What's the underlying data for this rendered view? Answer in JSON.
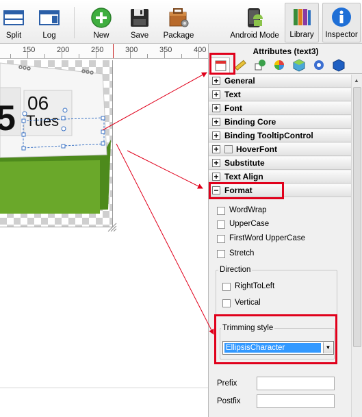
{
  "toolbar": {
    "split": "Split",
    "log": "Log",
    "new": "New",
    "save": "Save",
    "package": "Package",
    "android_mode": "Android Mode",
    "library": "Library",
    "inspector": "Inspector"
  },
  "ruler": {
    "marks": [
      "150",
      "200",
      "250",
      "300",
      "350",
      "400"
    ]
  },
  "canvas": {
    "calendar_day": "06",
    "calendar_weekday": "Tues",
    "calendar_big_digit": "5"
  },
  "inspector": {
    "title": "Attributes (text3)",
    "categories": [
      "General",
      "Text",
      "Font",
      "Binding Core",
      "Binding TooltipControl",
      "HoverFont",
      "Substitute",
      "Text Align",
      "Format"
    ],
    "format": {
      "wordwrap": "WordWrap",
      "uppercase": "UpperCase",
      "firstword_uppercase": "FirstWord UpperCase",
      "stretch": "Stretch",
      "direction_label": "Direction",
      "right_to_left": "RightToLeft",
      "vertical": "Vertical",
      "trimming_label": "Trimming style",
      "trimming_value": "EllipsisCharacter",
      "prefix_label": "Prefix",
      "postfix_label": "Postfix"
    }
  },
  "colors": {
    "accent": "#e0001b",
    "select_blue": "#3399ff"
  }
}
